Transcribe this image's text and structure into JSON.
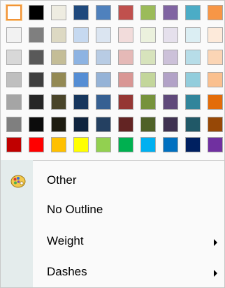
{
  "palette": {
    "rows": [
      [
        "#ffffff",
        "#000000",
        "#eeece1",
        "#1f497d",
        "#4f81bd",
        "#c0504d",
        "#9bbb59",
        "#8064a2",
        "#4bacc6",
        "#f79646"
      ],
      [
        "#f2f2f2",
        "#7f7f7f",
        "#ddd9c3",
        "#c6d9f0",
        "#dbe5f1",
        "#f2dcdb",
        "#ebf1dd",
        "#e5e0ec",
        "#dbeef3",
        "#fdeada"
      ],
      [
        "#d8d8d8",
        "#595959",
        "#c4bd97",
        "#8db3e2",
        "#b8cce4",
        "#e5b9b7",
        "#d7e3bc",
        "#ccc1d9",
        "#b7dde8",
        "#fbd5b5"
      ],
      [
        "#bfbfbf",
        "#3f3f3f",
        "#938953",
        "#548dd4",
        "#95b3d7",
        "#d99694",
        "#c3d69b",
        "#b2a2c7",
        "#92cddc",
        "#fac08f"
      ],
      [
        "#a5a5a5",
        "#262626",
        "#494429",
        "#17365d",
        "#366092",
        "#953734",
        "#76923c",
        "#5f497a",
        "#31859b",
        "#e36c09"
      ],
      [
        "#7f7f7f",
        "#0c0c0c",
        "#1d1b10",
        "#0f243e",
        "#244061",
        "#632423",
        "#4f6128",
        "#3f3151",
        "#205867",
        "#974806"
      ],
      [
        "#c00000",
        "#ff0000",
        "#ffc000",
        "#ffff00",
        "#92d050",
        "#00b050",
        "#00b0f0",
        "#0070c0",
        "#002060",
        "#7030a0"
      ]
    ],
    "selected": "#ffffff"
  },
  "menu": {
    "items": [
      {
        "label": "Other",
        "icon": "color-palette-icon",
        "submenu": false
      },
      {
        "label": "No Outline",
        "icon": "",
        "submenu": false
      },
      {
        "label": "Weight",
        "icon": "",
        "submenu": true
      },
      {
        "label": "Dashes",
        "icon": "",
        "submenu": true
      }
    ]
  }
}
